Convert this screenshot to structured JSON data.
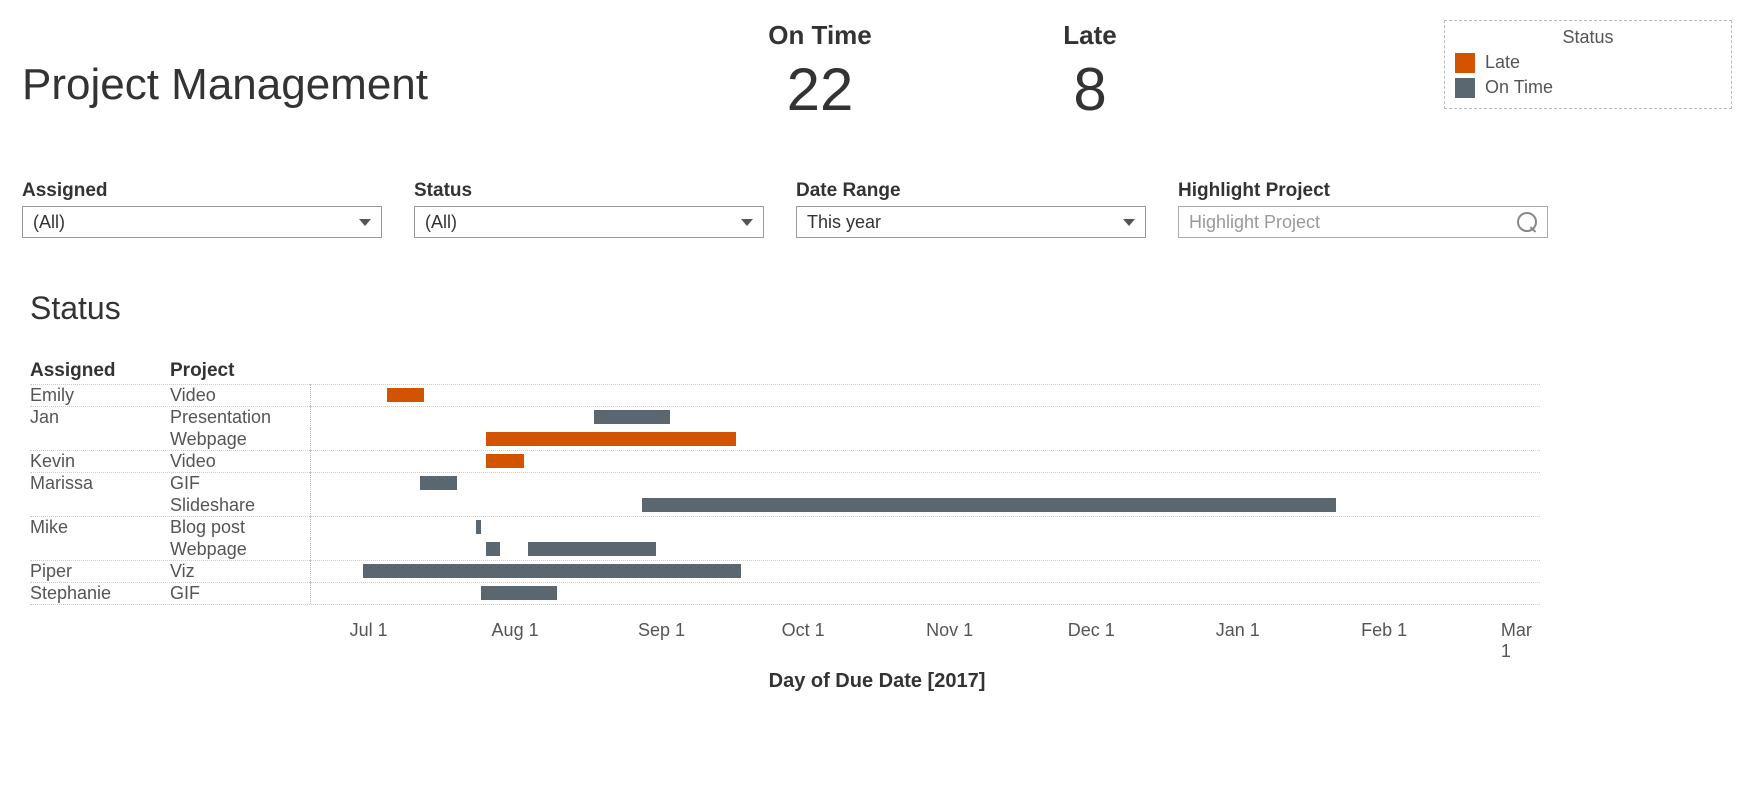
{
  "title": "Project Management",
  "kpis": {
    "on_time_label": "On Time",
    "on_time_value": "22",
    "late_label": "Late",
    "late_value": "8"
  },
  "legend": {
    "title": "Status",
    "late": "Late",
    "ontime": "On Time",
    "late_color": "#d35400",
    "ontime_color": "#5b6770"
  },
  "filters": {
    "assigned": {
      "label": "Assigned",
      "value": "(All)"
    },
    "status": {
      "label": "Status",
      "value": "(All)"
    },
    "range": {
      "label": "Date Range",
      "value": "This year"
    },
    "highlight": {
      "label": "Highlight Project",
      "placeholder": "Highlight Project"
    }
  },
  "section_title": "Status",
  "columns": {
    "assigned": "Assigned",
    "project": "Project"
  },
  "xlabel": "Day of Due Date [2017]",
  "chart_data": {
    "type": "bar",
    "orientation": "gantt",
    "title": "Status",
    "xlabel": "Day of Due Date [2017]",
    "x_ticks": [
      "Jul 1",
      "Aug 1",
      "Sep 1",
      "Oct 1",
      "Nov 1",
      "Dec 1",
      "Jan 1",
      "Feb 1",
      "Mar 1"
    ],
    "x_domain_days": [
      170,
      430
    ],
    "colors": {
      "Late": "#d35400",
      "On Time": "#5b6770"
    },
    "rows": [
      {
        "assigned": "Emily",
        "project": "Video",
        "start_day": 186,
        "end_day": 194,
        "status": "Late"
      },
      {
        "assigned": "Jan",
        "project": "Presentation",
        "start_day": 230,
        "end_day": 246,
        "status": "On Time"
      },
      {
        "assigned": "Jan",
        "project": "Webpage",
        "start_day": 207,
        "end_day": 260,
        "status": "Late"
      },
      {
        "assigned": "Kevin",
        "project": "Video",
        "start_day": 207,
        "end_day": 215,
        "status": "Late"
      },
      {
        "assigned": "Marissa",
        "project": "GIF",
        "start_day": 193,
        "end_day": 201,
        "status": "On Time"
      },
      {
        "assigned": "Marissa",
        "project": "Slideshare",
        "start_day": 240,
        "end_day": 387,
        "status": "On Time"
      },
      {
        "assigned": "Mike",
        "project": "Blog post",
        "start_day": 205,
        "end_day": 206,
        "status": "On Time"
      },
      {
        "assigned": "Mike",
        "project": "Webpage",
        "start_day": 207,
        "end_day": 210,
        "status": "On Time",
        "extra": {
          "start_day": 216,
          "end_day": 243,
          "status": "On Time"
        }
      },
      {
        "assigned": "Piper",
        "project": "Viz",
        "start_day": 181,
        "end_day": 261,
        "status": "On Time"
      },
      {
        "assigned": "Stephanie",
        "project": "GIF",
        "start_day": 206,
        "end_day": 222,
        "status": "On Time"
      }
    ]
  }
}
